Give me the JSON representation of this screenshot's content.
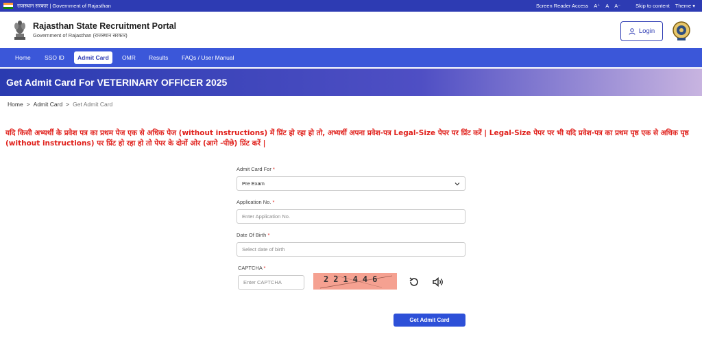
{
  "topbar": {
    "left_text": "राजस्थान सरकार | Government of Rajasthan",
    "links": [
      "Screen Reader Access",
      "A⁺",
      "A",
      "A⁻",
      "Skip to content",
      "Theme ▾"
    ]
  },
  "header": {
    "title": "Rajasthan State Recruitment Portal",
    "subtitle": "Government of Rajasthan (राजस्थान सरकार)",
    "login_label": "Login"
  },
  "nav": {
    "items": [
      "Home",
      "SSO ID",
      "Admit Card",
      "OMR",
      "Results",
      "FAQs / User Manual"
    ],
    "active": "Admit Card"
  },
  "page": {
    "title": "Get Admit Card For VETERINARY OFFICER 2025"
  },
  "breadcrumb": [
    "Home",
    ">",
    "Admit Card",
    ">",
    "Get Admit Card"
  ],
  "notice": "यदि किसी अभ्यर्थी के प्रवेश पत्र का प्रथम पेज एक से अधिक पेज (without instructions) में प्रिंट हो रहा हो तो, अभ्यर्थी अपना प्रवेश-पत्र Legal-Size पेपर पर प्रिंट करें | Legal-Size पेपर पर भी यदि प्रवेश-पत्र का प्रथम पृष्ठ एक से अधिक पृष्ठ (without instructions) पर प्रिंट हो रहा हो तो पेपर के दोनों ओर (आगे -पीछे) प्रिंट करें |",
  "form": {
    "admit_card_for": {
      "label": "Admit Card For",
      "value": "Pre Exam"
    },
    "application_no": {
      "label": "Application No.",
      "placeholder": "Enter Application No."
    },
    "dob": {
      "label": "Date Of Birth",
      "placeholder": "Select date of birth"
    },
    "captcha": {
      "label": "CAPTCHA",
      "placeholder": "Enter CAPTCHA",
      "code": "221446"
    },
    "required_mark": "*",
    "submit_label": "Get Admit Card"
  },
  "colors": {
    "primary": "#2d3bb3",
    "nav": "#3b57d9",
    "notice": "#e0201b"
  }
}
